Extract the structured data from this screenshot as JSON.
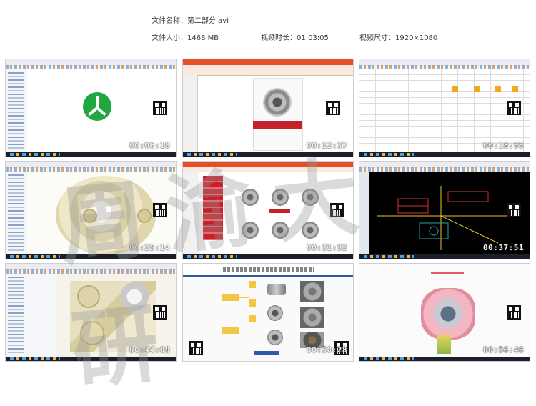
{
  "info": {
    "file_name": "文件名称：第二部分.avi",
    "file_size": "文件大小：1468 MB",
    "duration": "视频时长：01:03:05",
    "resolution": "视频尺寸：1920×1080"
  },
  "thumbnails": [
    {
      "timestamp": "00:06:18"
    },
    {
      "timestamp": "00:12:37"
    },
    {
      "timestamp": "00:18:55"
    },
    {
      "timestamp": "00:25:14"
    },
    {
      "timestamp": "00:31:32"
    },
    {
      "timestamp": "00:37:51"
    },
    {
      "timestamp": "00:44:09"
    },
    {
      "timestamp": "00:50:28"
    },
    {
      "timestamp": "00:56:46"
    }
  ],
  "watermark": "周渝大研",
  "colors": {
    "accent_green": "#21a641",
    "cad_bg": "#000000",
    "slide_red": "#c8202a",
    "slide_yellow": "#f3c744"
  }
}
